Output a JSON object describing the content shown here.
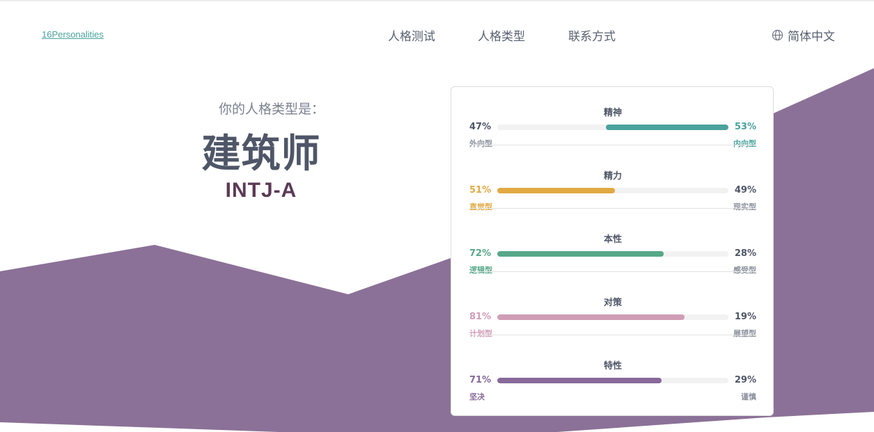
{
  "header": {
    "logo": "16Personalities",
    "nav": [
      "人格测试",
      "人格类型",
      "联系方式"
    ],
    "language": "简体中文"
  },
  "hero": {
    "subtitle": "你的人格类型是：",
    "type_name": "建筑师",
    "type_code": "INTJ-A"
  },
  "colors": {
    "background_shape": "#8b7197",
    "mind": "#4aa29d",
    "energy": "#e2a942",
    "nature": "#56a889",
    "tactics": "#d09db6",
    "identity": "#87699a",
    "neutral_text": "#4e5667",
    "muted_text": "#8a909c"
  },
  "traits": [
    {
      "title": "精神",
      "left_pct": "47%",
      "left_label": "外向型",
      "right_pct": "53%",
      "right_label": "内向型",
      "dominant": "right",
      "fill_fraction": 0.53,
      "color": "#4aa29d"
    },
    {
      "title": "精力",
      "left_pct": "51%",
      "left_label": "直觉型",
      "right_pct": "49%",
      "right_label": "现实型",
      "dominant": "left",
      "fill_fraction": 0.51,
      "color": "#e2a942"
    },
    {
      "title": "本性",
      "left_pct": "72%",
      "left_label": "逻辑型",
      "right_pct": "28%",
      "right_label": "感受型",
      "dominant": "left",
      "fill_fraction": 0.72,
      "color": "#56a889"
    },
    {
      "title": "对策",
      "left_pct": "81%",
      "left_label": "计划型",
      "right_pct": "19%",
      "right_label": "展望型",
      "dominant": "left",
      "fill_fraction": 0.81,
      "color": "#d09db6"
    },
    {
      "title": "特性",
      "left_pct": "71%",
      "left_label": "坚决",
      "right_pct": "29%",
      "right_label": "谨慎",
      "dominant": "left",
      "fill_fraction": 0.71,
      "color": "#87699a"
    }
  ]
}
